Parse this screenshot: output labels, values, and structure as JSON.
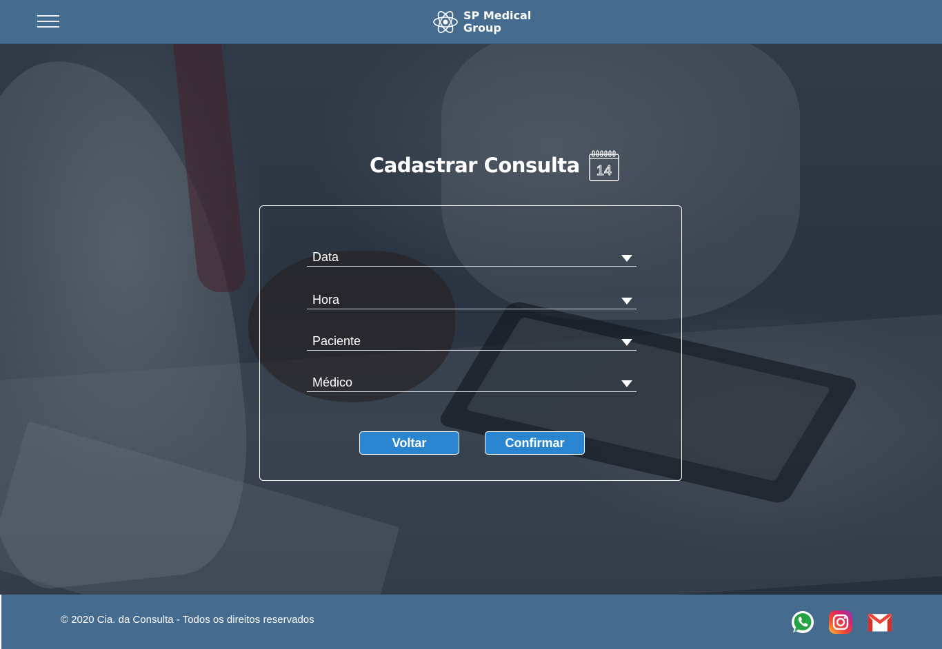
{
  "header": {
    "menu_icon": "hamburger-menu-icon",
    "logo_icon": "atom-icon",
    "logo_text": "SP Medical\nGroup"
  },
  "main": {
    "title": "Cadastrar Consulta",
    "title_icon": "calendar-icon",
    "calendar_day": "14",
    "fields": [
      {
        "label": "Data",
        "icon": "chevron-down-icon"
      },
      {
        "label": "Hora",
        "icon": "chevron-down-icon"
      },
      {
        "label": "Paciente",
        "icon": "chevron-down-icon"
      },
      {
        "label": "Médico",
        "icon": "chevron-down-icon"
      }
    ],
    "buttons": {
      "back_label": "Voltar",
      "confirm_label": "Confirmar"
    }
  },
  "footer": {
    "copyright": "© 2020 Cia. da Consulta - Todos os direitos reservados",
    "social": [
      "whatsapp-icon",
      "instagram-icon",
      "gmail-icon"
    ]
  },
  "colors": {
    "header_bg": "#456b8f",
    "button_bg": "#2a86d1",
    "text": "#ffffff"
  }
}
